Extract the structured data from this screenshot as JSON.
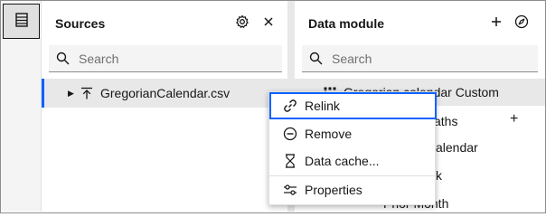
{
  "sources": {
    "title": "Sources",
    "search_placeholder": "Search",
    "file": "GregorianCalendar.csv"
  },
  "data_module": {
    "title": "Data module",
    "search_placeholder": "Search",
    "items": [
      "Gregorian calendar Custom",
      "aths",
      "alendar",
      "k",
      "Prior Month"
    ]
  },
  "context_menu": {
    "items": [
      "Relink",
      "Remove",
      "Data cache...",
      "Properties"
    ]
  },
  "colors": {
    "accent": "#0f62fe",
    "selected_bg": "#e8e8e8"
  }
}
